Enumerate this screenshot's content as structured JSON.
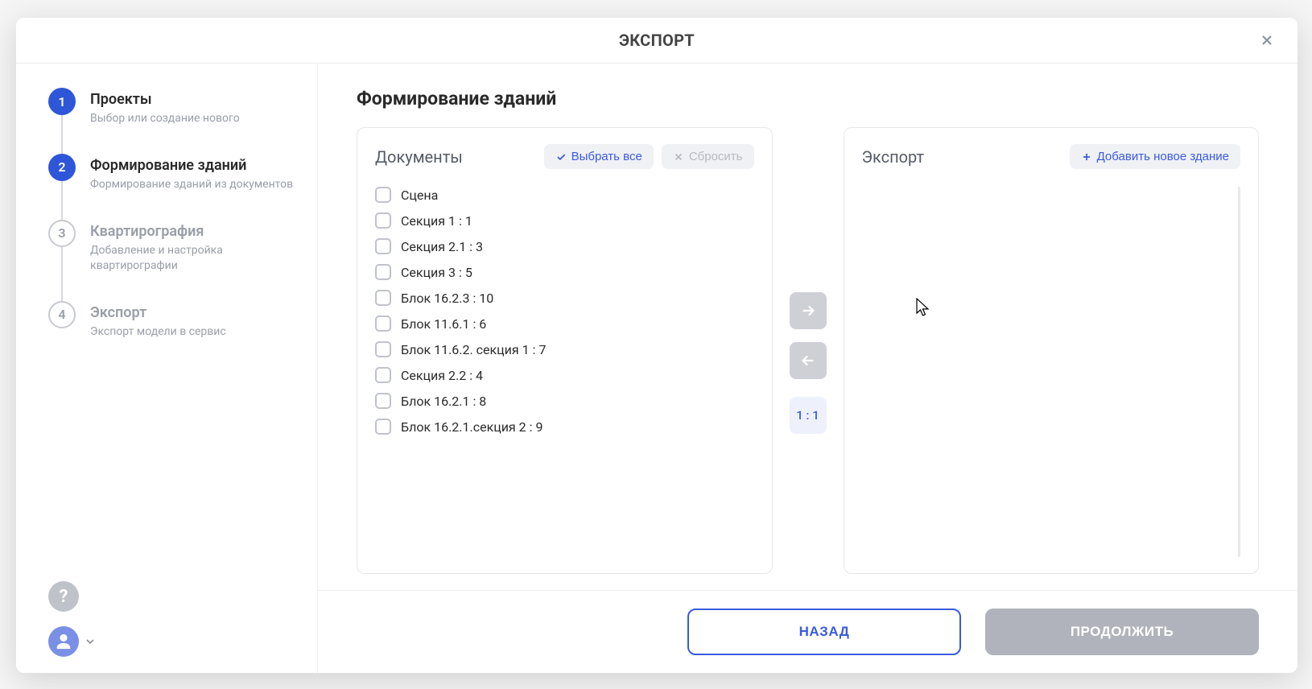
{
  "modal": {
    "title": "ЭКСПОРТ"
  },
  "steps": [
    {
      "num": "1",
      "title": "Проекты",
      "sub": "Выбор или создание нового",
      "active": true
    },
    {
      "num": "2",
      "title": "Формирование зданий",
      "sub": "Формирование зданий из документов",
      "active": true
    },
    {
      "num": "3",
      "title": "Квартирография",
      "sub": "Добавление и настройка квартирографии",
      "active": false
    },
    {
      "num": "4",
      "title": "Экспорт",
      "sub": "Экспорт модели в сервис",
      "active": false
    }
  ],
  "page": {
    "title": "Формирование зданий"
  },
  "documents": {
    "title": "Документы",
    "select_all_label": "Выбрать все",
    "reset_label": "Сбросить",
    "items": [
      {
        "label": "Сцена"
      },
      {
        "label": "Секция 1 : 1"
      },
      {
        "label": "Секция 2.1 : 3"
      },
      {
        "label": "Секция 3 : 5"
      },
      {
        "label": "Блок 16.2.3 : 10"
      },
      {
        "label": "Блок 11.6.1 : 6"
      },
      {
        "label": "Блок 11.6.2. секция 1 : 7"
      },
      {
        "label": "Секция 2.2 : 4"
      },
      {
        "label": "Блок 16.2.1 : 8"
      },
      {
        "label": "Блок 16.2.1.секция 2 : 9"
      }
    ]
  },
  "transfer": {
    "ratio": "1 : 1"
  },
  "export_pane": {
    "title": "Экспорт",
    "add_label": "Добавить новое здание"
  },
  "footer": {
    "back_label": "НАЗАД",
    "continue_label": "ПРОДОЛЖИТЬ"
  }
}
